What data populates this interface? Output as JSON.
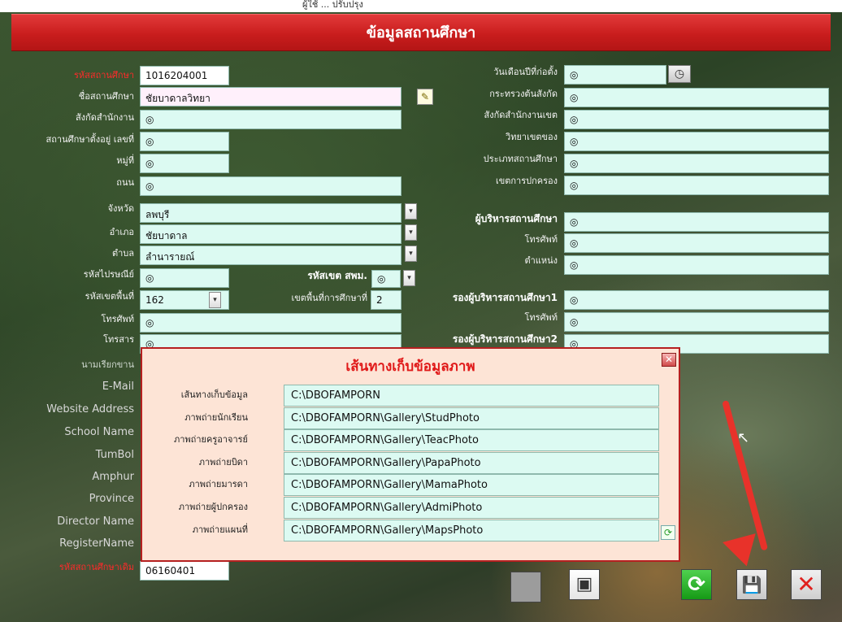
{
  "window": {
    "caption": "ผู้ใช้ ... ปรับปรุง"
  },
  "header": {
    "title": "ข้อมูลสถานศึกษา"
  },
  "left": {
    "school_code_label": "รหัสสถานศึกษา",
    "school_code": "1016204001",
    "school_name_label": "ชื่อสถานศึกษา",
    "school_name": "ชัยบาดาลวิทยา",
    "office_label": "สังกัดสำนักงาน",
    "office": "◎",
    "address_no_label": "สถานศึกษาตั้งอยู่ เลขที่",
    "address_no": "◎",
    "moo_label": "หมู่ที่",
    "moo": "◎",
    "road_label": "ถนน",
    "road": "◎",
    "province_label": "จังหวัด",
    "province": "ลพบุรี",
    "district_label": "อำเภอ",
    "district": "ชัยบาดาล",
    "subdistrict_label": "ตำบล",
    "subdistrict": "ลำนารายณ์",
    "postal_label": "รหัสไปรษณีย์",
    "postal": "◎",
    "area_code_label": "รหัสเขตพื้นที่",
    "area_code": "162",
    "phone_label": "โทรศัพท์",
    "phone": "◎",
    "fax_label": "โทรสาร",
    "fax": "◎",
    "nickname_label": "นามเรียกขาน",
    "email_label": "E-Mail",
    "website_label": "Website Address",
    "school_name_en_label": "School Name",
    "tumbol_label": "TumBol",
    "amphur_label": "Amphur",
    "province_en_label": "Province",
    "director_label": "Director Name",
    "register_label": "RegisterName",
    "old_code_label": "รหัสสถานศึกษาเดิม",
    "old_code": "06160401"
  },
  "middle": {
    "spm_code_label": "รหัสเขต สพม.",
    "spm_code": "◎",
    "edu_area_label": "เขตพื้นที่การศึกษาที่",
    "edu_area": "2"
  },
  "right": {
    "founded_label": "วันเดือนปีที่ก่อตั้ง",
    "founded": "◎",
    "ministry_label": "กระทรวงต้นสังกัด",
    "ministry": "◎",
    "district_office_label": "สังกัดสำนักงานเขต",
    "district_office": "◎",
    "college_area_label": "วิทยาเขตของ",
    "college_area": "◎",
    "school_type_label": "ประเภทสถานศึกษา",
    "school_type": "◎",
    "admin_zone_label": "เขตการปกครอง",
    "admin_zone": "◎",
    "director_header": "ผู้บริหารสถานศึกษา",
    "director": "◎",
    "director_phone_label": "โทรศัพท์",
    "director_phone": "◎",
    "position_label": "ตำแหน่ง",
    "position": "◎",
    "deputy1_header": "รองผู้บริหารสถานศึกษา1",
    "deputy1": "◎",
    "deputy1_phone_label": "โทรศัพท์",
    "deputy1_phone": "◎",
    "deputy2_header": "รองผู้บริหารสถานศึกษา2",
    "deputy2": "◎"
  },
  "dialog": {
    "title": "เส้นทางเก็บข้อมูลภาพ",
    "rows": [
      {
        "label": "เส้นทางเก็บข้อมูล",
        "value": "C:\\DBOFAMPORN"
      },
      {
        "label": "ภาพถ่ายนักเรียน",
        "value": "C:\\DBOFAMPORN\\Gallery\\StudPhoto"
      },
      {
        "label": "ภาพถ่ายครูอาจารย์",
        "value": "C:\\DBOFAMPORN\\Gallery\\TeacPhoto"
      },
      {
        "label": "ภาพถ่ายบิดา",
        "value": "C:\\DBOFAMPORN\\Gallery\\PapaPhoto"
      },
      {
        "label": "ภาพถ่ายมารดา",
        "value": "C:\\DBOFAMPORN\\Gallery\\MamaPhoto"
      },
      {
        "label": "ภาพถ่ายผู้ปกครอง",
        "value": "C:\\DBOFAMPORN\\Gallery\\AdmiPhoto"
      },
      {
        "label": "ภาพถ่ายแผนที่",
        "value": "C:\\DBOFAMPORN\\Gallery\\MapsPhoto"
      }
    ]
  },
  "icons": {
    "dropdown": "▾",
    "clock": "◷",
    "edit": "✎",
    "close": "✕",
    "refresh": "⟳",
    "cursor": "↖",
    "picture": "▣",
    "save": "💾"
  },
  "colors": {
    "banner": "#c91d1d",
    "field": "#dcfaf2",
    "label_red": "#ff2a2a",
    "dialog_bg": "#fde4d6",
    "arrow": "#e8322a"
  }
}
